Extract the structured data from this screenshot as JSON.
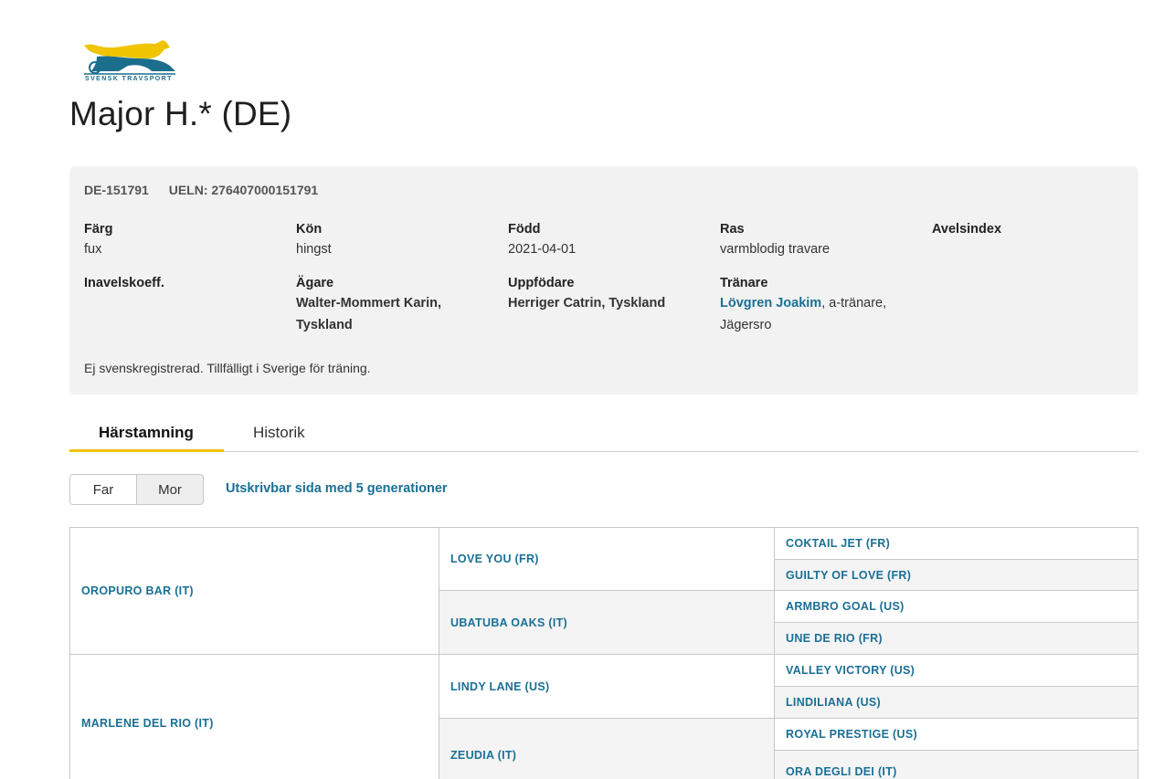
{
  "brand": {
    "logo_text": "SVENSK TRAVSPORT"
  },
  "horse": {
    "name": "Major H.* (DE)",
    "reg_no": "DE-151791",
    "ueln": "UELN: 276407000151791"
  },
  "details": {
    "color": {
      "label": "Färg",
      "value": "fux"
    },
    "sex": {
      "label": "Kön",
      "value": "hingst"
    },
    "born": {
      "label": "Född",
      "value": "2021-04-01"
    },
    "breed": {
      "label": "Ras",
      "value": "varmblodig travare"
    },
    "breeding_index": {
      "label": "Avelsindex",
      "value": ""
    },
    "inbreeding": {
      "label": "Inavelskoeff.",
      "value": ""
    },
    "owner": {
      "label": "Ägare",
      "line1": "Walter-Mommert Karin,",
      "line2": "Tyskland"
    },
    "breeder": {
      "label": "Uppfödare",
      "value": "Herriger Catrin, Tyskland"
    },
    "trainer": {
      "label": "Tränare",
      "name": "Lövgren Joakim",
      "suffix": ", a-tränare,",
      "line2": "Jägersro"
    },
    "note": "Ej svenskregistrerad. Tillfälligt i Sverige för träning."
  },
  "tabs": [
    {
      "label": "Härstamning"
    },
    {
      "label": "Historik"
    }
  ],
  "toggle": {
    "far": "Far",
    "mor": "Mor"
  },
  "print_link": "Utskrivbar sida med 5 generationer",
  "pedigree": {
    "g1": [
      "OROPURO BAR (IT)",
      "MARLENE DEL RIO (IT)"
    ],
    "g2": [
      "LOVE YOU (FR)",
      "UBATUBA OAKS (IT)",
      "LINDY LANE (US)",
      "ZEUDIA (IT)"
    ],
    "g3": [
      "COKTAIL JET (FR)",
      "GUILTY OF LOVE (FR)",
      "ARMBRO GOAL (US)",
      "UNE DE RIO (FR)",
      "VALLEY VICTORY (US)",
      "LINDILIANA (US)",
      "ROYAL PRESTIGE (US)",
      "ORA DEGLI DEI (IT)"
    ]
  },
  "colors": {
    "link": "#1a6f95",
    "accent": "#f0c400",
    "card_bg": "#f2f2f2"
  }
}
